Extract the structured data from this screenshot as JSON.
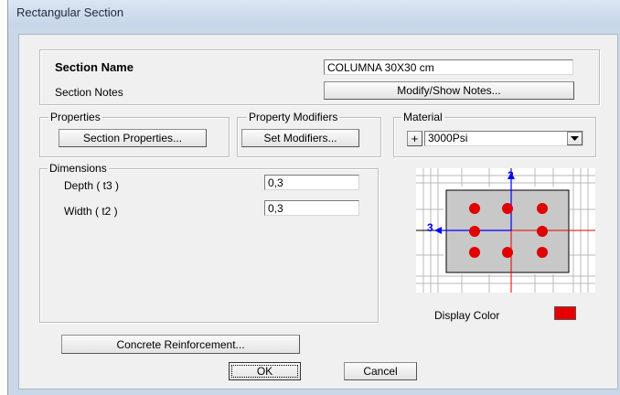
{
  "window": {
    "title": "Rectangular Section"
  },
  "section": {
    "name_label": "Section Name",
    "name_value": "COLUMNA 30X30 cm",
    "notes_label": "Section Notes",
    "notes_button": "Modify/Show Notes..."
  },
  "properties": {
    "group_label": "Properties",
    "button": "Section Properties..."
  },
  "modifiers": {
    "group_label": "Property Modifiers",
    "button": "Set Modifiers..."
  },
  "material": {
    "group_label": "Material",
    "add_symbol": "+",
    "selected": "3000Psi"
  },
  "dimensions": {
    "group_label": "Dimensions",
    "depth_label": "Depth  ( t3 )",
    "depth_value": "0,3",
    "width_label": "Width  ( t2 )",
    "width_value": "0,3"
  },
  "preview": {
    "axis_vertical": "2",
    "axis_horizontal": "3",
    "axis_color": "#0000ff",
    "bar_color": "#e00000",
    "section_fill": "#c8c8c8"
  },
  "display_color": {
    "label": "Display Color",
    "value": "#e80000"
  },
  "buttons": {
    "reinforcement": "Concrete Reinforcement...",
    "ok": "OK",
    "cancel": "Cancel"
  }
}
